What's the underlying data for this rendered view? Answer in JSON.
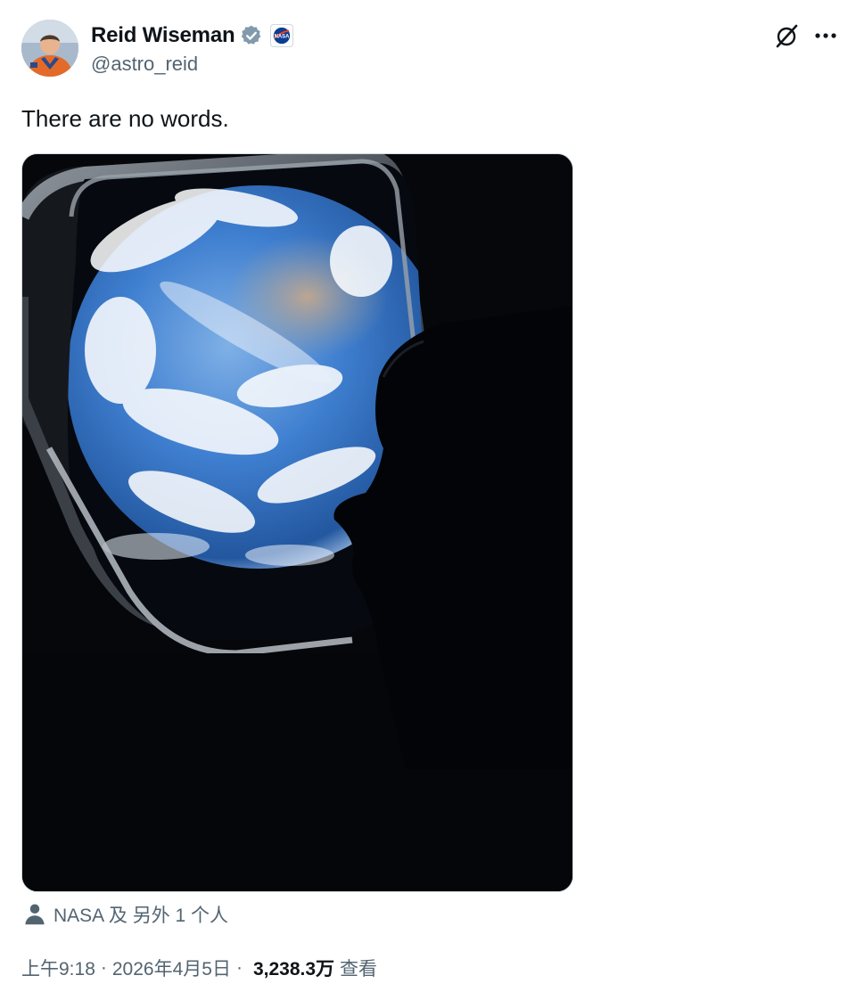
{
  "author": {
    "display_name": "Reid Wiseman",
    "handle": "@astro_reid",
    "verified_icon": "verified-badge-icon",
    "org_badge_icon": "nasa-logo-icon"
  },
  "actions": {
    "grok_icon": "grok-icon",
    "more_icon": "more-options-icon"
  },
  "tweet": {
    "text": "There are no words.",
    "media_alt": "photo-earth-through-spacecraft-window"
  },
  "tagged": {
    "icon": "person-icon",
    "text": "NASA 及 另外 1 个人"
  },
  "meta": {
    "time": "上午9:18",
    "separator1": "·",
    "date": "2026年4月5日",
    "separator2": "·",
    "views_count": "3,238.3万",
    "views_label": "查看"
  },
  "colors": {
    "text_primary": "#0f1419",
    "text_secondary": "#536471",
    "verified_gray": "#829aab",
    "border": "#cfd9de"
  }
}
